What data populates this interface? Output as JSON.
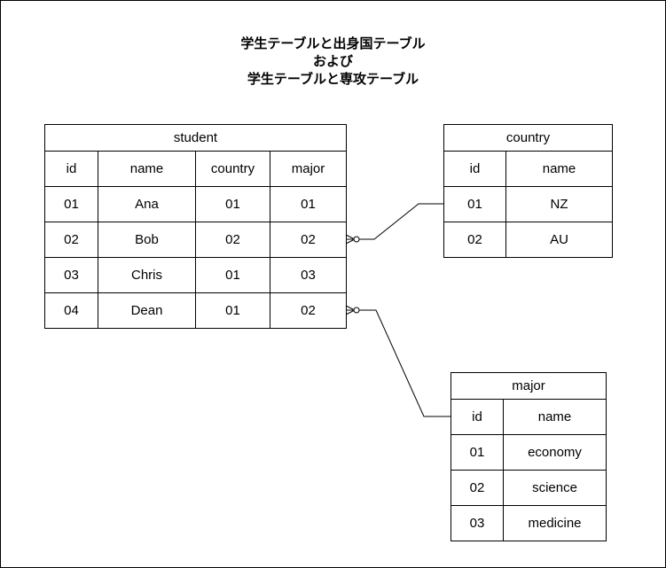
{
  "title": {
    "line1": "学生テーブルと出身国テーブル",
    "line2": "および",
    "line3": "学生テーブルと専攻テーブル"
  },
  "tables": {
    "student": {
      "name": "student",
      "columns": [
        "id",
        "name",
        "country",
        "major"
      ],
      "rows": [
        [
          "01",
          "Ana",
          "01",
          "01"
        ],
        [
          "02",
          "Bob",
          "02",
          "02"
        ],
        [
          "03",
          "Chris",
          "01",
          "03"
        ],
        [
          "04",
          "Dean",
          "01",
          "02"
        ]
      ]
    },
    "country": {
      "name": "country",
      "columns": [
        "id",
        "name"
      ],
      "rows": [
        [
          "01",
          "NZ"
        ],
        [
          "02",
          "AU"
        ]
      ]
    },
    "major": {
      "name": "major",
      "columns": [
        "id",
        "name"
      ],
      "rows": [
        [
          "01",
          "economy"
        ],
        [
          "02",
          "science"
        ],
        [
          "03",
          "medicine"
        ]
      ]
    }
  }
}
